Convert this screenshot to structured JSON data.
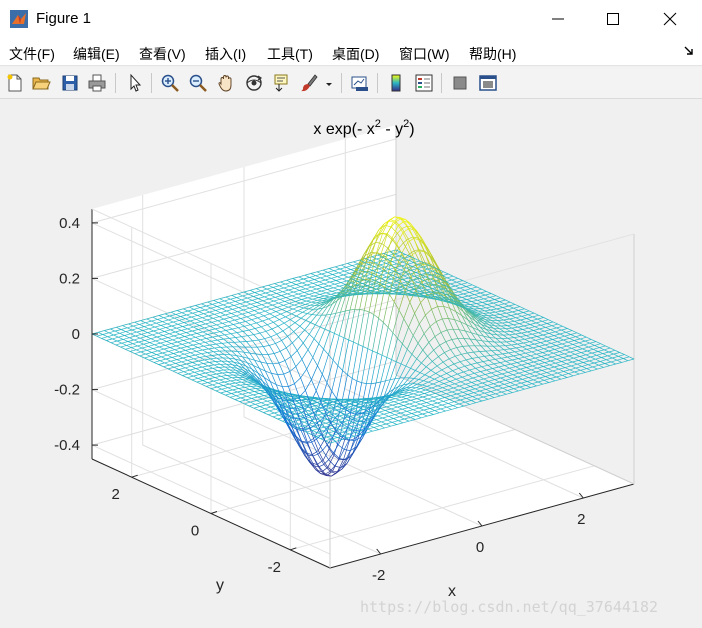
{
  "window": {
    "title": "Figure 1",
    "controls": {
      "minimize": "minimize-icon",
      "maximize": "maximize-icon",
      "close": "close-icon"
    }
  },
  "menu": {
    "items": [
      {
        "label": "文件(F)"
      },
      {
        "label": "编辑(E)"
      },
      {
        "label": "查看(V)"
      },
      {
        "label": "插入(I)"
      },
      {
        "label": "工具(T)"
      },
      {
        "label": "桌面(D)"
      },
      {
        "label": "窗口(W)"
      },
      {
        "label": "帮助(H)"
      }
    ],
    "dock_icon": "dock-arrow-icon"
  },
  "toolbar": {
    "tools": [
      "new-figure-icon",
      "open-file-icon",
      "save-icon",
      "print-icon",
      "pointer-icon",
      "zoom-in-icon",
      "zoom-out-icon",
      "pan-hand-icon",
      "rotate-3d-icon",
      "data-cursor-icon",
      "brush-icon",
      "brush-dropdown-icon",
      "link-plot-icon",
      "colorbar-icon",
      "legend-icon",
      "hide-plot-tools-icon",
      "show-plot-tools-icon"
    ]
  },
  "colors": {
    "surface_low": "#352a87",
    "surface_mid": "#2ab6c6",
    "surface_high": "#f9fb0e",
    "axis_line": "#262626",
    "grid": "#e0e0e0"
  },
  "chart_data": {
    "type": "mesh",
    "function": "z = x*exp(-x^2 - y^2)",
    "title": "x exp(- x^2 - y^2)",
    "title_parts": {
      "base": "x exp(- x",
      "sup1": "2",
      "mid": " - y",
      "sup2": "2",
      "end": ")"
    },
    "xlabel": "x",
    "ylabel": "y",
    "zlabel": "",
    "xlim": [
      -3,
      3
    ],
    "ylim": [
      -3,
      3
    ],
    "zlim": [
      -0.45,
      0.45
    ],
    "xticks": [
      {
        "value": -2,
        "label": "-2"
      },
      {
        "value": 0,
        "label": "0"
      },
      {
        "value": 2,
        "label": "2"
      }
    ],
    "yticks": [
      {
        "value": -2,
        "label": "-2"
      },
      {
        "value": 0,
        "label": "0"
      },
      {
        "value": 2,
        "label": "2"
      }
    ],
    "zticks": [
      {
        "value": -0.4,
        "label": "-0.4"
      },
      {
        "value": -0.2,
        "label": "-0.2"
      },
      {
        "value": 0,
        "label": "0"
      },
      {
        "value": 0.2,
        "label": "0.2"
      },
      {
        "value": 0.4,
        "label": "0.4"
      }
    ],
    "grid": true,
    "colormap": "parula",
    "view": "3-D default (azimuth -37.5, elevation 30)",
    "peak": {
      "x": 0.71,
      "y": 0,
      "z": 0.43
    },
    "trough": {
      "x": -0.71,
      "y": 0,
      "z": -0.43
    }
  },
  "watermark": "https://blog.csdn.net/qq_37644182"
}
